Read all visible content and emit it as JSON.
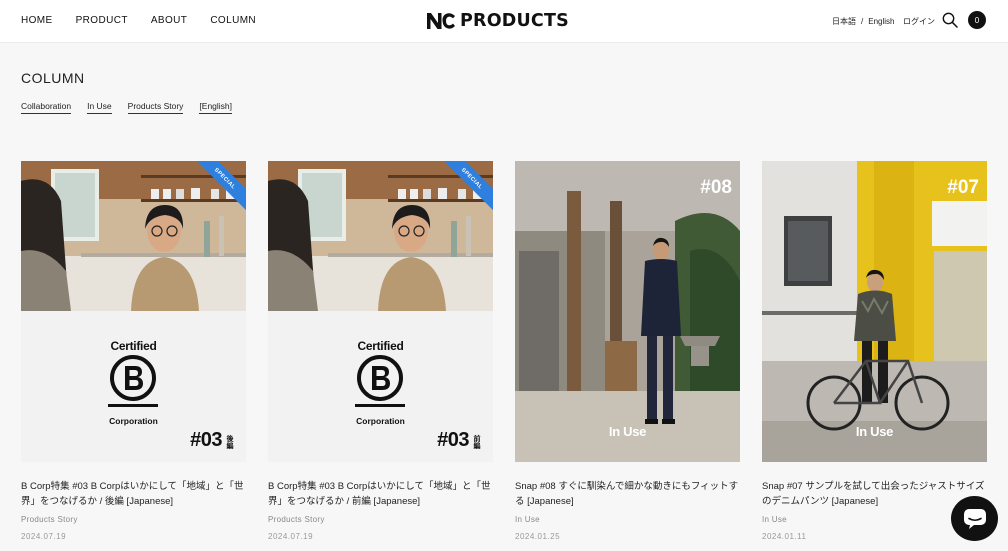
{
  "nav": {
    "items": [
      "HOME",
      "PRODUCT",
      "ABOUT",
      "COLUMN"
    ],
    "logo_text": "PRODUCTS",
    "lang_ja": "日本語",
    "lang_sep": "/",
    "lang_en": "English",
    "login": "ログイン",
    "cart_count": "0"
  },
  "page": {
    "title": "COLUMN",
    "categories": [
      "Collaboration",
      "In Use",
      "Products Story",
      "[English]"
    ]
  },
  "cards": [
    {
      "ribbon": "SPECIAL",
      "cert_line1": "Certified",
      "cert_line2": "Corporation",
      "issue": "#03",
      "part": "後編",
      "title": "B Corp特集 #03 B Corpはいかにして「地域」と「世界」をつなげるか / 後編 [Japanese]",
      "category": "Products Story",
      "date": "2024.07.19"
    },
    {
      "ribbon": "SPECIAL",
      "cert_line1": "Certified",
      "cert_line2": "Corporation",
      "issue": "#03",
      "part": "前編",
      "title": "B Corp特集 #03 B Corpはいかにして「地域」と「世界」をつなげるか / 前編 [Japanese]",
      "category": "Products Story",
      "date": "2024.07.19"
    },
    {
      "episode": "#08",
      "overlay": "In Use",
      "title": "Snap #08 すぐに馴染んで細かな動きにもフィットする [Japanese]",
      "category": "In Use",
      "date": "2024.01.25"
    },
    {
      "episode": "#07",
      "overlay": "In Use",
      "title": "Snap #07 サンプルを試して出会ったジャストサイズのデニムパンツ [Japanese]",
      "category": "In Use",
      "date": "2024.01.11"
    }
  ],
  "colors": {
    "ribbon": "#2f7fde",
    "yellow_wall": "#e8c21c",
    "cart_badge": "#111111"
  }
}
